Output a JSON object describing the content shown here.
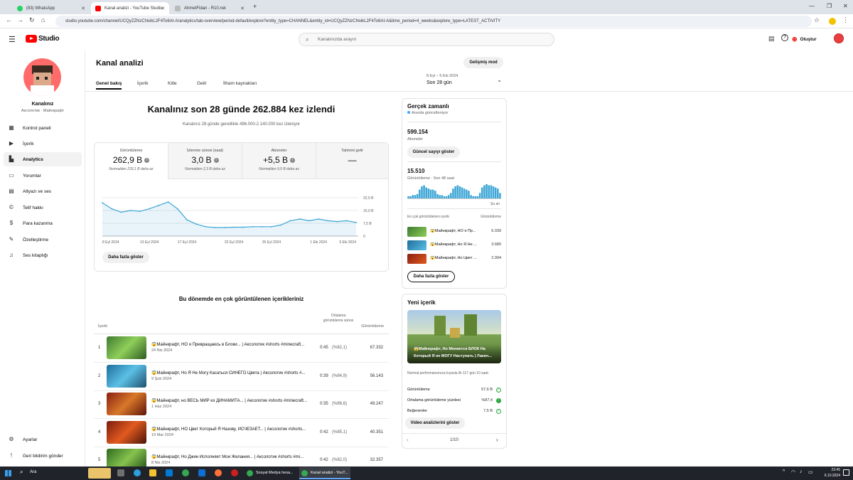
{
  "browser": {
    "tabs": [
      {
        "label": "(83) WhatsApp"
      },
      {
        "label": "Kanal analizi - YouTube Studio"
      },
      {
        "label": "AhmetFidan - R10.net"
      }
    ],
    "url": "studio.youtube.com/channel/UCQyZZNzCNxikL2F4To6AI-A/analytics/tab-overview/period-default/explore?entity_type=CHANNEL&entity_id=UCQyZZNzCNxikL2F4To6AI-A&time_period=4_weeks&explore_type=LATEST_ACTIVITY"
  },
  "header": {
    "logo_text": "Studio",
    "search_placeholder": "Kanalınızda arayın",
    "create_label": "Oluştur"
  },
  "sidebar": {
    "channel_title": "Kanalınız",
    "channel_subtitle": "Аксолотик · Майнкрафт",
    "items": [
      {
        "label": "Kontrol paneli",
        "icon": "dashboard-icon"
      },
      {
        "label": "İçerik",
        "icon": "content-icon"
      },
      {
        "label": "Analytics",
        "icon": "analytics-icon"
      },
      {
        "label": "Yorumlar",
        "icon": "comments-icon"
      },
      {
        "label": "Altyazı ve ses",
        "icon": "subtitles-icon"
      },
      {
        "label": "Telif hakkı",
        "icon": "copyright-icon"
      },
      {
        "label": "Para kazanma",
        "icon": "monetization-icon"
      },
      {
        "label": "Özelleştirme",
        "icon": "customization-icon"
      },
      {
        "label": "Ses kitaplığı",
        "icon": "audio-library-icon"
      }
    ],
    "bottom_items": [
      {
        "label": "Ayarlar",
        "icon": "settings-icon"
      },
      {
        "label": "Geri bildirim gönder",
        "icon": "feedback-icon"
      }
    ]
  },
  "page": {
    "title": "Kanal analizi",
    "advanced_mode": "Gelişmiş mod",
    "tabs": [
      "Genel bakış",
      "İçerik",
      "Kitle",
      "Gelir",
      "İlham kaynakları"
    ],
    "period_range": "8 Eyl – 5 Eki 2024",
    "period_label": "Son 28 gün"
  },
  "overview": {
    "headline": "Kanalınız son 28 günde 262.884 kez izlendi",
    "subline": "Kanalınız 28 günde genellikle 496.000-2.140.000 kez izleniyor",
    "metrics": [
      {
        "label": "Görüntüleme",
        "value": "262,9 B",
        "sub": "Normalden 233,1 B daha az"
      },
      {
        "label": "İzlenme süresi (saat)",
        "value": "3,0 B",
        "sub": "Normalden 2,3 B daha az"
      },
      {
        "label": "Aboneler",
        "value": "+5,5 B",
        "sub": "Normalden 9,5 B daha az"
      },
      {
        "label": "Tahmini gelir",
        "value": "—",
        "sub": ""
      }
    ],
    "show_more": "Daha fazla göster"
  },
  "chart_data": {
    "type": "area",
    "x": [
      "8 Eyl 2024",
      "9 Eyl",
      "10 Eyl",
      "11 Eyl",
      "12 Eyl",
      "13 Eyl 2024",
      "14 Eyl",
      "15 Eyl",
      "16 Eyl",
      "17 Eyl 2024",
      "18 Eyl",
      "19 Eyl",
      "20 Eyl",
      "21 Eyl",
      "22 Eyl 2024",
      "23 Eyl",
      "24 Eyl",
      "25 Eyl",
      "26 Eyl 2024",
      "27 Eyl",
      "28 Eyl",
      "29 Eyl",
      "30 Eyl",
      "1 Eki 2024",
      "2 Eki",
      "3 Eki",
      "4 Eki",
      "5 Eki 2024"
    ],
    "values": [
      19.5,
      16,
      14,
      15,
      14.5,
      16,
      18,
      20,
      16,
      9.5,
      7,
      5.5,
      5,
      5,
      5.2,
      5.2,
      5.5,
      5.5,
      5.5,
      6.5,
      9,
      10,
      9,
      10,
      9,
      8.5,
      9,
      8
    ],
    "x_tick_labels": [
      "8 Eyl 2024",
      "13 Eyl 2024",
      "17 Eyl 2024",
      "22 Eyl 2024",
      "26 Eyl 2024",
      "1 Eki 2024",
      "5 Eki 2024"
    ],
    "x_tick_index": [
      0,
      5,
      9,
      14,
      18,
      23,
      27
    ],
    "y_tick_labels": [
      "22,5 B",
      "15,0 B",
      "7,5 B",
      "0"
    ],
    "y_ticks": [
      22.5,
      15,
      7.5,
      0
    ],
    "ylim": [
      0,
      22.5
    ],
    "color": "#3ea6d6"
  },
  "top_content": {
    "title": "Bu dönemde en çok görüntülenen içerikleriniz",
    "col_content": "İçerik",
    "col_avg": "Ortalama görüntüleme süresi",
    "col_views": "Görüntüleme",
    "rows": [
      {
        "rank": "1",
        "title": "😱Майнкрафт, НО я Превращаюсь в Блоки... | Аксолотик #shorts #minecraft...",
        "date": "24 Nis 2024",
        "duration": "0:45",
        "pct": "(%82,1)",
        "views": "67.332"
      },
      {
        "rank": "2",
        "title": "😱Майнкрафт, Но Я Не Могу Касаться СИНЕГО Цвета | Аксолотик #shorts #...",
        "date": "9 Şub 2024",
        "duration": "0:39",
        "pct": "(%84,9)",
        "views": "56.143"
      },
      {
        "rank": "3",
        "title": "😱Майнкрафт, но ВЕСЬ МИР из ДИНАМИТА... | Аксолотик #shorts #minecraft...",
        "date": "1 Haz 2024",
        "duration": "0:35",
        "pct": "(%86,6)",
        "views": "49.247"
      },
      {
        "rank": "4",
        "title": "😱Майнкрафт, НО Цвет Который Я Назову, ИСЧЕЗАЕТ... | Аксолотик #shorts...",
        "date": "19 Mar 2024",
        "duration": "0:42",
        "pct": "(%85,1)",
        "views": "40.351"
      },
      {
        "rank": "5",
        "title": "😱Майнкрафт, Но Джин Исполняет Мои Желания... | Аксолотик #shorts #mi...",
        "date": "8 Nis 2024",
        "duration": "0:42",
        "pct": "(%82,0)",
        "views": "32.357"
      }
    ]
  },
  "realtime": {
    "title": "Gerçek zamanlı",
    "live_label": "Anında güncelleniyor",
    "subscribers_value": "599.154",
    "subscribers_label": "Aboneler",
    "show_live_count": "Güncel sayıyı göster",
    "views_value": "15.510",
    "views_label": "Görüntüleme · Son 48 saat",
    "bars": [
      2,
      2,
      3,
      3,
      4,
      8,
      11,
      12,
      10,
      9,
      8,
      8,
      7,
      4,
      3,
      3,
      2,
      2,
      3,
      5,
      9,
      11,
      12,
      11,
      10,
      9,
      8,
      7,
      3,
      2,
      2,
      2,
      5,
      10,
      12,
      13,
      12,
      12,
      11,
      10,
      9,
      5
    ],
    "now_label": "Şu an",
    "top_label": "En çok görüntülenen içerik",
    "top_col": "Görüntüleme",
    "top_items": [
      {
        "title": "😱Майнкрафт, НО я Пр...",
        "views": "6.039"
      },
      {
        "title": "😱Майнкрафт, Но Я Не ...",
        "views": "3.680"
      },
      {
        "title": "😱Майнкрафт, Но Цвет ...",
        "views": "2.994"
      }
    ],
    "show_more": "Daha fazla göster"
  },
  "latest": {
    "title": "Yeni içerik",
    "video_title_line1": "😱Майнкрафт, Но Меняется БЛОК На",
    "video_title_line2": "Который Я не МОГУ Наступать | Лакич...",
    "comparison_note": "Normal performansınıza kıyasla ilk 117 gün 10 saat:",
    "stats": [
      {
        "label": "Görüntüleme",
        "value": "57,6 B"
      },
      {
        "label": "Ortalama görüntüleme yüzdesi",
        "value": "%87,4"
      },
      {
        "label": "Beğenenler",
        "value": "7,5 B"
      }
    ],
    "button": "Video analizlerini göster",
    "pager": "1/10"
  },
  "taskbar": {
    "search": "Ara",
    "tasks": [
      {
        "label": "Sosyal Medya hesa..."
      },
      {
        "label": "Kanal analizi - YouT..."
      }
    ],
    "time": "23:45",
    "date": "6.10.2024"
  }
}
